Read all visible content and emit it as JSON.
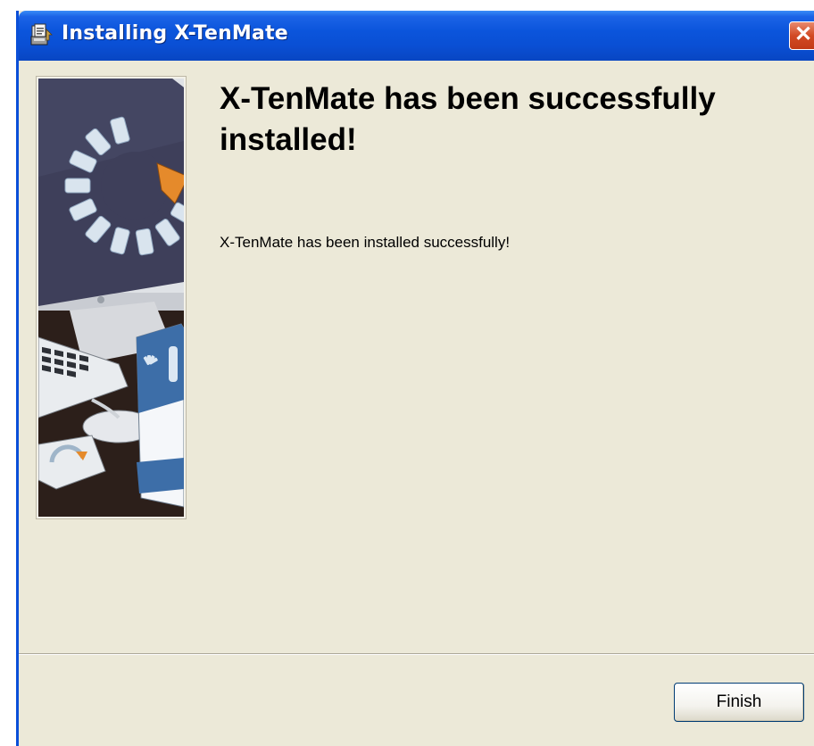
{
  "window": {
    "title": "Installing X-TenMate",
    "close_glyph": "✕",
    "title_icon": "installer-icon",
    "colors": {
      "titlebar": "#0a4fd8",
      "close": "#d24a24",
      "body": "#ece9d8"
    }
  },
  "main": {
    "heading": "X-TenMate has been successfully installed!",
    "message": "X-TenMate has been installed successfully!",
    "side_image": "installer-illustration"
  },
  "footer": {
    "finish_label": "Finish"
  }
}
